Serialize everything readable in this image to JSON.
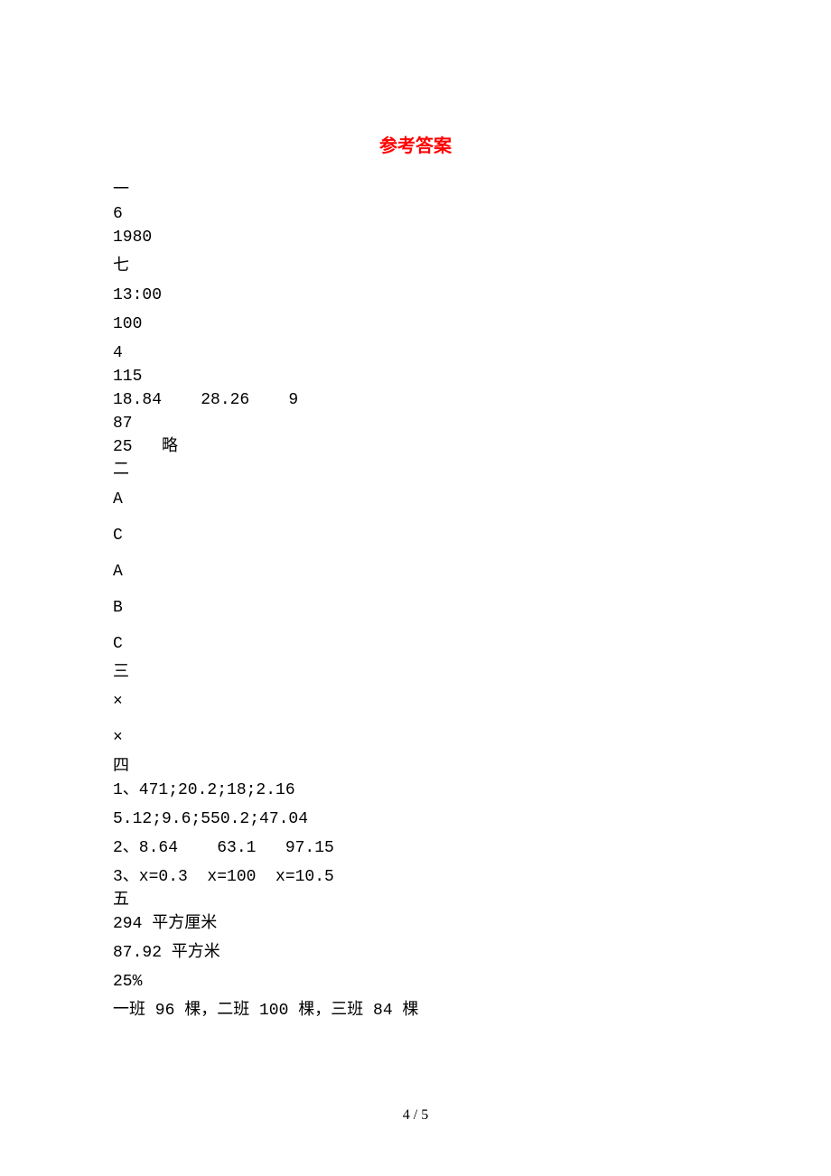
{
  "title": "参考答案",
  "section1": {
    "header": "一",
    "lines": [
      "6",
      "1980",
      "七",
      "13:00",
      "100",
      "4",
      "115",
      "18.84    28.26    9",
      "87",
      "25   略"
    ]
  },
  "section2": {
    "header": "二",
    "lines": [
      "A",
      "C",
      "A",
      "B",
      "C"
    ]
  },
  "section3": {
    "header": "三",
    "lines": [
      "×",
      "×"
    ]
  },
  "section4": {
    "header": "四",
    "lines": [
      "1、471;20.2;18;2.16",
      "5.12;9.6;550.2;47.04",
      "2、8.64    63.1   97.15",
      "3、x=0.3  x=100  x=10.5"
    ]
  },
  "section5": {
    "header": "五",
    "lines": [
      "294 平方厘米",
      "87.92 平方米",
      "25%",
      "一班 96 棵，二班 100 棵，三班 84 棵"
    ]
  },
  "pageNumber": "4 / 5"
}
